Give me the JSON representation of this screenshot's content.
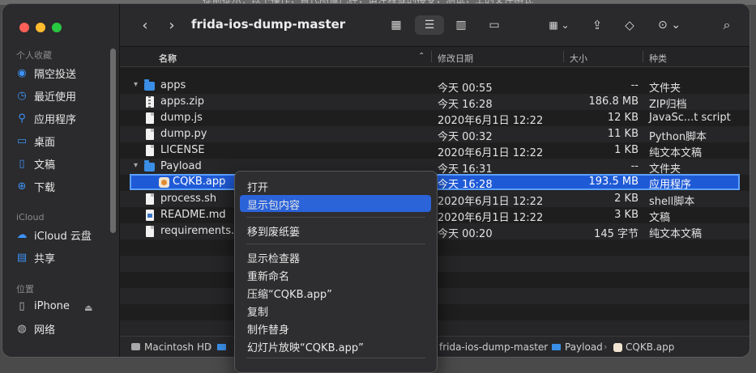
{
  "background": {
    "text": "提前提示：以下操作，替代图像已经，请注释或的接受，测试，工的文件格式"
  },
  "window": {
    "title": "frida-ios-dump-master"
  },
  "sidebar": {
    "sections": [
      {
        "label": "个人收藏"
      },
      {
        "label": "iCloud"
      },
      {
        "label": "位置"
      }
    ],
    "items": [
      {
        "label": "隔空投送",
        "icon": "airdrop-icon"
      },
      {
        "label": "最近使用",
        "icon": "clock-icon"
      },
      {
        "label": "应用程序",
        "icon": "apps-icon"
      },
      {
        "label": "桌面",
        "icon": "desktop-icon"
      },
      {
        "label": "文稿",
        "icon": "document-icon"
      },
      {
        "label": "下载",
        "icon": "download-icon"
      },
      {
        "label": "iCloud 云盘",
        "icon": "cloud-icon"
      },
      {
        "label": "共享",
        "icon": "shared-folder-icon"
      },
      {
        "label": "iPhone",
        "icon": "iphone-icon"
      },
      {
        "label": "网络",
        "icon": "network-icon"
      }
    ]
  },
  "columns": {
    "name": "名称",
    "modified": "修改日期",
    "size": "大小",
    "kind": "种类"
  },
  "files": [
    {
      "name": "apps",
      "date": "今天 00:55",
      "size": "--",
      "kind": "文件夹"
    },
    {
      "name": "apps.zip",
      "date": "今天 16:28",
      "size": "186.8 MB",
      "kind": "ZIP归档"
    },
    {
      "name": "dump.js",
      "date": "2020年6月1日 12:22",
      "size": "12 KB",
      "kind": "JavaSc...t script"
    },
    {
      "name": "dump.py",
      "date": "今天 00:32",
      "size": "11 KB",
      "kind": "Python脚本"
    },
    {
      "name": "LICENSE",
      "date": "2020年6月1日 12:22",
      "size": "1 KB",
      "kind": "纯文本文稿"
    },
    {
      "name": "Payload",
      "date": "今天 16:31",
      "size": "--",
      "kind": "文件夹"
    },
    {
      "name": "CQKB.app",
      "date": "今天 16:28",
      "size": "193.5 MB",
      "kind": "应用程序"
    },
    {
      "name": "process.sh",
      "date": "2020年6月1日 12:22",
      "size": "2 KB",
      "kind": "shell脚本"
    },
    {
      "name": "README.md",
      "date": "2020年6月1日 12:22",
      "size": "3 KB",
      "kind": "文稿"
    },
    {
      "name": "requirements.txt",
      "date": "今天 00:20",
      "size": "145 字节",
      "kind": "纯文本文稿"
    }
  ],
  "pathbar": {
    "items": [
      "Macintosh HD",
      "frida-ios-dump-master",
      "Payload",
      "CQKB.app"
    ]
  },
  "context_menu": {
    "items": [
      "打开",
      "显示包内容",
      "移到废纸篓",
      "显示检查器",
      "重新命名",
      "压缩“CQKB.app”",
      "复制",
      "制作替身",
      "幻灯片放映“CQKB.app”"
    ]
  },
  "colors": {
    "accent": "#2b63d9",
    "selection": "#1f5ad6",
    "folder": "#3a8ee6"
  }
}
